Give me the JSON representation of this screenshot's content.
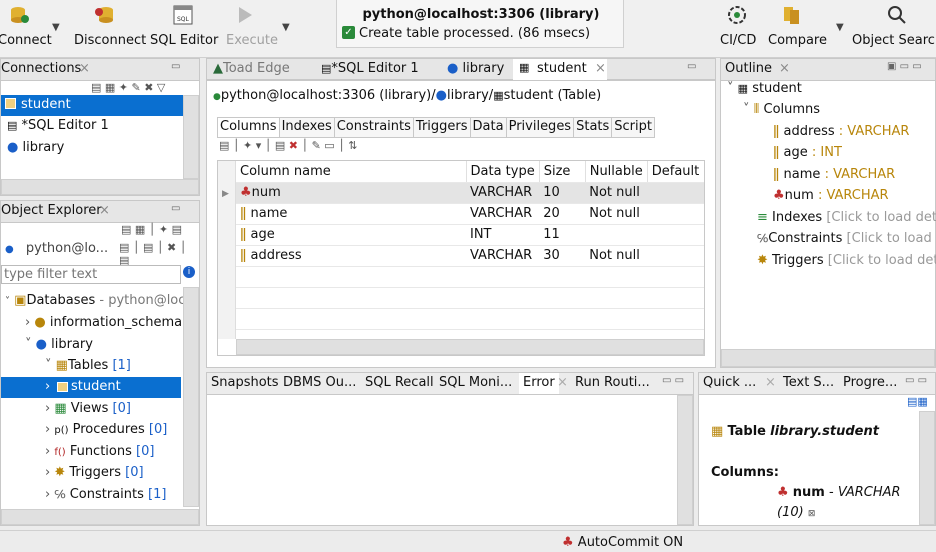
{
  "toolbar": {
    "connect": "Connect",
    "disconnect": "Disconnect",
    "sql_editor": "SQL Editor",
    "execute": "Execute",
    "cicd": "CI/CD",
    "compare": "Compare",
    "object_search": "Object Search"
  },
  "notification": {
    "title": "python@localhost:3306 (library)",
    "message": "Create table processed. (86 msecs)"
  },
  "connections": {
    "tab": "Connections",
    "items": [
      "student",
      "*SQL Editor 1",
      "library"
    ]
  },
  "object_explorer": {
    "tab": "Object Explorer",
    "connection": "python@lo...",
    "filter_placeholder": "type filter text",
    "databases": "Databases",
    "databases_suffix": "- python@loca",
    "information_schema": "information_schema",
    "library": "library",
    "tables": "Tables",
    "tables_count": "[1]",
    "student": "student",
    "views": "Views",
    "views_count": "[0]",
    "procedures": "Procedures",
    "procedures_count": "[0]",
    "functions": "Functions",
    "functions_count": "[0]",
    "triggers": "Triggers",
    "triggers_count": "[0]",
    "constraints": "Constraints",
    "constraints_count": "[1]"
  },
  "editor": {
    "tabs": [
      "Toad Edge",
      "*SQL Editor 1",
      "library",
      "student"
    ],
    "breadcrumb_conn": "python@localhost:3306 (library)/",
    "breadcrumb_db": "library/",
    "breadcrumb_table": "student (Table)",
    "subtabs": [
      "Columns",
      "Indexes",
      "Constraints",
      "Triggers",
      "Data",
      "Privileges",
      "Stats",
      "Script"
    ],
    "headers": [
      "Column name",
      "Data type",
      "Size",
      "Nullable",
      "Default"
    ],
    "rows": [
      {
        "name": "num",
        "type": "VARCHAR",
        "size": "10",
        "nullable": "Not null"
      },
      {
        "name": "name",
        "type": "VARCHAR",
        "size": "20",
        "nullable": "Not null"
      },
      {
        "name": "age",
        "type": "INT",
        "size": "11",
        "nullable": ""
      },
      {
        "name": "address",
        "type": "VARCHAR",
        "size": "30",
        "nullable": "Not null"
      }
    ]
  },
  "outline": {
    "tab": "Outline",
    "student": "student",
    "columns": "Columns",
    "cols": [
      {
        "name": "address",
        "type": ": VARCHAR"
      },
      {
        "name": "age",
        "type": ": INT"
      },
      {
        "name": "name",
        "type": ": VARCHAR"
      },
      {
        "name": "num",
        "type": ": VARCHAR"
      }
    ],
    "indexes": "Indexes",
    "indexes_hint": "[Click to load detail",
    "constraints": "Constraints",
    "constraints_hint": "[Click to load de",
    "triggers": "Triggers",
    "triggers_hint": "[Click to load detai"
  },
  "bottom_tabs": [
    "Snapshots",
    "DBMS Ou...",
    "SQL Recall",
    "SQL Moni...",
    "Error",
    "Run Routi..."
  ],
  "quick": {
    "tabs": [
      "Quick ...",
      "Text S...",
      "Progre..."
    ],
    "table_label": "Table",
    "table_name": "library.student",
    "columns_label": "Columns:",
    "col_name": "num",
    "col_dash": "-",
    "col_type": "VARCHAR",
    "col_size": "(10)"
  },
  "status": {
    "autocommit": "AutoCommit ON"
  }
}
